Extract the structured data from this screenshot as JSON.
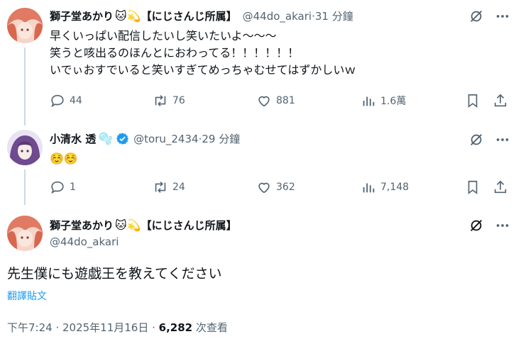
{
  "tweet1": {
    "author": "獅子堂あかり",
    "author_emojis": "🐱💫",
    "affiliation": "【にじさんじ所属】",
    "handle": "@44do_akari",
    "time": "31 分鐘",
    "lines": [
      "早くいっぱい配信したいし笑いたいよ〜〜〜",
      "笑うと咳出るのほんとにおわってる！！！！！！",
      "いでぃおすでいると笑いすぎてめっちゃむせてはずかしいｗ"
    ],
    "replies": "44",
    "reposts": "76",
    "likes": "881",
    "views": "1.6萬"
  },
  "tweet2": {
    "author": "小清水 透",
    "author_emoji": "🫧",
    "handle": "@toru_2434",
    "time": "29 分鐘",
    "text": "☺️☺️",
    "replies": "1",
    "reposts": "24",
    "likes": "362",
    "views": "7,148"
  },
  "tweet3": {
    "author": "獅子堂あかり",
    "author_emojis": "🐱💫",
    "affiliation": "【にじさんじ所属】",
    "handle": "@44do_akari",
    "text": "先生僕にも遊戯王を教えてください",
    "translate": "翻譯貼文",
    "timestamp": "下午7:24 · 2025年11月16日 · ",
    "views_count": "6,282",
    "views_label": " 次查看"
  },
  "separator": " · ",
  "colors": {
    "text": "#0f1419",
    "secondary": "#536471",
    "accent": "#1d9bf0",
    "thread_line": "#cfd9de"
  }
}
